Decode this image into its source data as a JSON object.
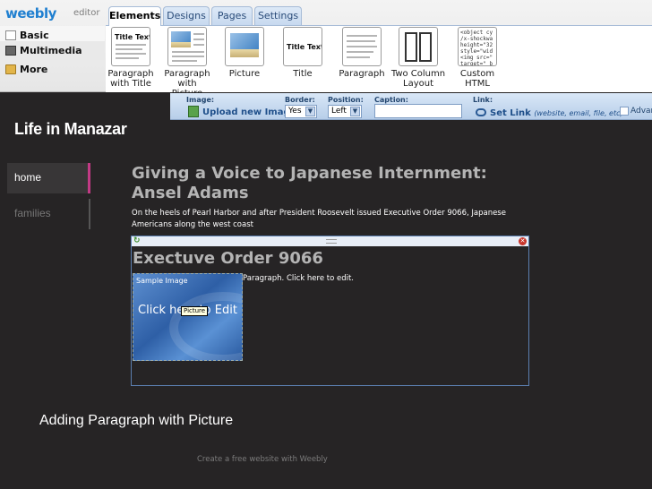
{
  "editor": {
    "logo": "weebly",
    "logo_sub": "editor",
    "tabs": [
      {
        "label": "Elements",
        "active": true
      },
      {
        "label": "Designs",
        "active": false
      },
      {
        "label": "Pages",
        "active": false
      },
      {
        "label": "Settings",
        "active": false
      }
    ],
    "categories": [
      "Basic",
      "Multimedia",
      "More"
    ],
    "elements": [
      {
        "label": "Paragraph with Title",
        "preview_title": "Title Text"
      },
      {
        "label": "Paragraph with Picture"
      },
      {
        "label": "Picture"
      },
      {
        "label": "Title",
        "preview_title": "Title Text"
      },
      {
        "label": "Paragraph"
      },
      {
        "label": "Two Column Layout"
      },
      {
        "label": "Custom HTML",
        "preview_code": "<object cy\n/x-shockwa\nheight=\"32\nstyle=\"wid\n<img src=\"\ntarget=\"_b"
      }
    ]
  },
  "properties": {
    "image_label": "Image:",
    "upload_label": "Upload new Image",
    "border_label": "Border:",
    "border_value": "Yes",
    "position_label": "Position:",
    "position_value": "Left",
    "caption_label": "Caption:",
    "caption_value": "",
    "link_label": "Link:",
    "set_link_label": "Set Link",
    "set_link_hint": "(website, email, file, etc)",
    "advanced_label": "Advan"
  },
  "site": {
    "title": "Life in Manazar",
    "nav": [
      "home",
      "families"
    ],
    "heading": "Giving a Voice to Japanese Internment: Ansel Adams",
    "intro": "On the heels of Pearl Harbor and after President Roosevelt issued Executive Order 9066, Japanese Americans along the west coast",
    "block_heading": "Exectuve Order 9066",
    "sample_image_label": "Sample Image",
    "click_to_edit": "Click here to Edit",
    "tooltip": "Picture",
    "paragraph_text": "Paragraph. Click here to edit.",
    "footer": "Create a free website with Weebly"
  },
  "slide_caption": "Adding Paragraph with Picture"
}
